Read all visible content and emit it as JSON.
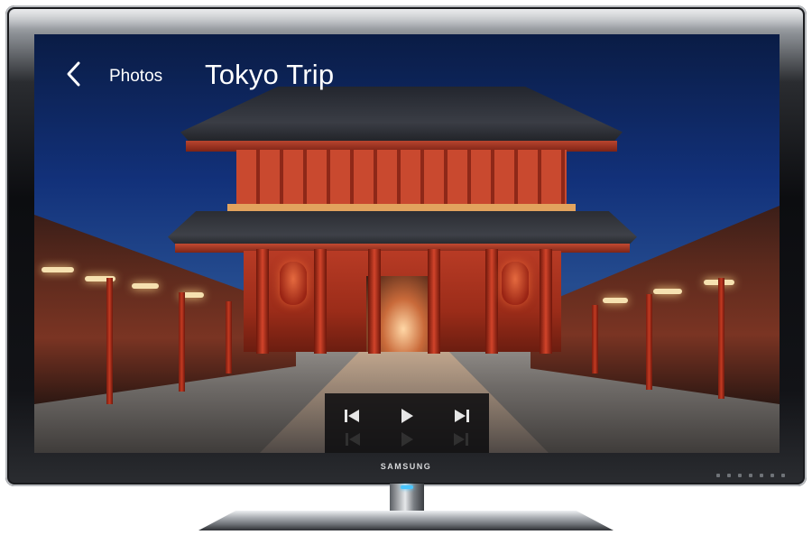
{
  "device": {
    "brand": "SAMSUNG"
  },
  "header": {
    "back_icon": "chevron-left-icon",
    "breadcrumb": "Photos",
    "title": "Tokyo Trip"
  },
  "playback_controls": {
    "previous_icon": "skip-previous-icon",
    "play_icon": "play-icon",
    "next_icon": "skip-next-icon"
  },
  "colors": {
    "ui_text": "#ffffff",
    "control_bar_bg": "#0e0e10"
  }
}
